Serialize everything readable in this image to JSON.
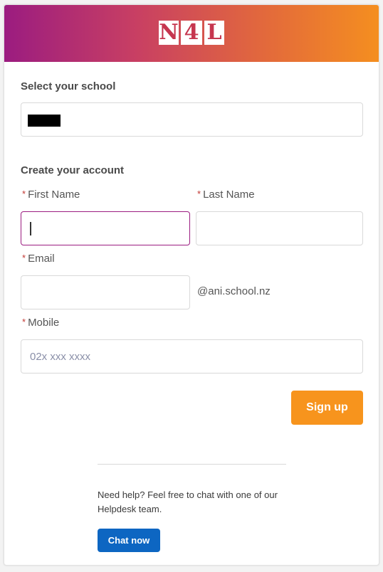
{
  "brand": {
    "logo_text": "N4L",
    "header_gradient": [
      "#9b1c80",
      "#c83f63",
      "#e36a3b",
      "#f58f1f"
    ]
  },
  "school": {
    "title": "Select your school",
    "value": ""
  },
  "account": {
    "title": "Create your account",
    "required_marker": "*",
    "first_name_label": "First Name",
    "last_name_label": "Last Name",
    "email_label": "Email",
    "email_domain": "@ani.school.nz",
    "mobile_label": "Mobile",
    "mobile_placeholder": "02x xxx xxxx"
  },
  "actions": {
    "signup_label": "Sign up",
    "signup_color": "#f7941d"
  },
  "help": {
    "text": "Need help? Feel free to chat with one of our Helpdesk team.",
    "chat_label": "Chat now",
    "chat_color": "#0d66c2"
  }
}
